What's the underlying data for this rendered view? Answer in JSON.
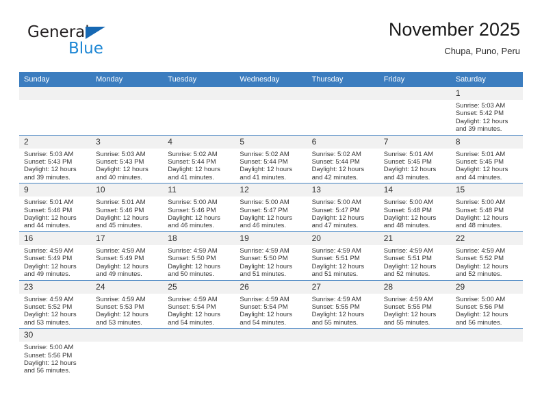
{
  "brand": {
    "name_part1": "General",
    "name_part2": "Blue",
    "accent_color": "#1c86d4",
    "logo_triangle_color": "#1668b3"
  },
  "header": {
    "month_title": "November 2025",
    "location": "Chupa, Puno, Peru"
  },
  "theme": {
    "header_row_color": "#3C7DBF",
    "daynum_band_color": "#F1F1F1",
    "text_color": "#333333"
  },
  "weekday_headers": [
    "Sunday",
    "Monday",
    "Tuesday",
    "Wednesday",
    "Thursday",
    "Friday",
    "Saturday"
  ],
  "labels": {
    "sunrise_prefix": "Sunrise:",
    "sunset_prefix": "Sunset:",
    "daylight_prefix": "Daylight:"
  },
  "weeks": [
    [
      {
        "day": "",
        "empty": true
      },
      {
        "day": "",
        "empty": true
      },
      {
        "day": "",
        "empty": true
      },
      {
        "day": "",
        "empty": true
      },
      {
        "day": "",
        "empty": true
      },
      {
        "day": "",
        "empty": true
      },
      {
        "day": "1",
        "sunrise": "Sunrise: 5:03 AM",
        "sunset": "Sunset: 5:42 PM",
        "daylight": "Daylight: 12 hours and 39 minutes."
      }
    ],
    [
      {
        "day": "2",
        "sunrise": "Sunrise: 5:03 AM",
        "sunset": "Sunset: 5:43 PM",
        "daylight": "Daylight: 12 hours and 39 minutes."
      },
      {
        "day": "3",
        "sunrise": "Sunrise: 5:03 AM",
        "sunset": "Sunset: 5:43 PM",
        "daylight": "Daylight: 12 hours and 40 minutes."
      },
      {
        "day": "4",
        "sunrise": "Sunrise: 5:02 AM",
        "sunset": "Sunset: 5:44 PM",
        "daylight": "Daylight: 12 hours and 41 minutes."
      },
      {
        "day": "5",
        "sunrise": "Sunrise: 5:02 AM",
        "sunset": "Sunset: 5:44 PM",
        "daylight": "Daylight: 12 hours and 41 minutes."
      },
      {
        "day": "6",
        "sunrise": "Sunrise: 5:02 AM",
        "sunset": "Sunset: 5:44 PM",
        "daylight": "Daylight: 12 hours and 42 minutes."
      },
      {
        "day": "7",
        "sunrise": "Sunrise: 5:01 AM",
        "sunset": "Sunset: 5:45 PM",
        "daylight": "Daylight: 12 hours and 43 minutes."
      },
      {
        "day": "8",
        "sunrise": "Sunrise: 5:01 AM",
        "sunset": "Sunset: 5:45 PM",
        "daylight": "Daylight: 12 hours and 44 minutes."
      }
    ],
    [
      {
        "day": "9",
        "sunrise": "Sunrise: 5:01 AM",
        "sunset": "Sunset: 5:46 PM",
        "daylight": "Daylight: 12 hours and 44 minutes."
      },
      {
        "day": "10",
        "sunrise": "Sunrise: 5:01 AM",
        "sunset": "Sunset: 5:46 PM",
        "daylight": "Daylight: 12 hours and 45 minutes."
      },
      {
        "day": "11",
        "sunrise": "Sunrise: 5:00 AM",
        "sunset": "Sunset: 5:46 PM",
        "daylight": "Daylight: 12 hours and 46 minutes."
      },
      {
        "day": "12",
        "sunrise": "Sunrise: 5:00 AM",
        "sunset": "Sunset: 5:47 PM",
        "daylight": "Daylight: 12 hours and 46 minutes."
      },
      {
        "day": "13",
        "sunrise": "Sunrise: 5:00 AM",
        "sunset": "Sunset: 5:47 PM",
        "daylight": "Daylight: 12 hours and 47 minutes."
      },
      {
        "day": "14",
        "sunrise": "Sunrise: 5:00 AM",
        "sunset": "Sunset: 5:48 PM",
        "daylight": "Daylight: 12 hours and 48 minutes."
      },
      {
        "day": "15",
        "sunrise": "Sunrise: 5:00 AM",
        "sunset": "Sunset: 5:48 PM",
        "daylight": "Daylight: 12 hours and 48 minutes."
      }
    ],
    [
      {
        "day": "16",
        "sunrise": "Sunrise: 4:59 AM",
        "sunset": "Sunset: 5:49 PM",
        "daylight": "Daylight: 12 hours and 49 minutes."
      },
      {
        "day": "17",
        "sunrise": "Sunrise: 4:59 AM",
        "sunset": "Sunset: 5:49 PM",
        "daylight": "Daylight: 12 hours and 49 minutes."
      },
      {
        "day": "18",
        "sunrise": "Sunrise: 4:59 AM",
        "sunset": "Sunset: 5:50 PM",
        "daylight": "Daylight: 12 hours and 50 minutes."
      },
      {
        "day": "19",
        "sunrise": "Sunrise: 4:59 AM",
        "sunset": "Sunset: 5:50 PM",
        "daylight": "Daylight: 12 hours and 51 minutes."
      },
      {
        "day": "20",
        "sunrise": "Sunrise: 4:59 AM",
        "sunset": "Sunset: 5:51 PM",
        "daylight": "Daylight: 12 hours and 51 minutes."
      },
      {
        "day": "21",
        "sunrise": "Sunrise: 4:59 AM",
        "sunset": "Sunset: 5:51 PM",
        "daylight": "Daylight: 12 hours and 52 minutes."
      },
      {
        "day": "22",
        "sunrise": "Sunrise: 4:59 AM",
        "sunset": "Sunset: 5:52 PM",
        "daylight": "Daylight: 12 hours and 52 minutes."
      }
    ],
    [
      {
        "day": "23",
        "sunrise": "Sunrise: 4:59 AM",
        "sunset": "Sunset: 5:52 PM",
        "daylight": "Daylight: 12 hours and 53 minutes."
      },
      {
        "day": "24",
        "sunrise": "Sunrise: 4:59 AM",
        "sunset": "Sunset: 5:53 PM",
        "daylight": "Daylight: 12 hours and 53 minutes."
      },
      {
        "day": "25",
        "sunrise": "Sunrise: 4:59 AM",
        "sunset": "Sunset: 5:54 PM",
        "daylight": "Daylight: 12 hours and 54 minutes."
      },
      {
        "day": "26",
        "sunrise": "Sunrise: 4:59 AM",
        "sunset": "Sunset: 5:54 PM",
        "daylight": "Daylight: 12 hours and 54 minutes."
      },
      {
        "day": "27",
        "sunrise": "Sunrise: 4:59 AM",
        "sunset": "Sunset: 5:55 PM",
        "daylight": "Daylight: 12 hours and 55 minutes."
      },
      {
        "day": "28",
        "sunrise": "Sunrise: 4:59 AM",
        "sunset": "Sunset: 5:55 PM",
        "daylight": "Daylight: 12 hours and 55 minutes."
      },
      {
        "day": "29",
        "sunrise": "Sunrise: 5:00 AM",
        "sunset": "Sunset: 5:56 PM",
        "daylight": "Daylight: 12 hours and 56 minutes."
      }
    ],
    [
      {
        "day": "30",
        "sunrise": "Sunrise: 5:00 AM",
        "sunset": "Sunset: 5:56 PM",
        "daylight": "Daylight: 12 hours and 56 minutes."
      },
      {
        "day": "",
        "empty": true
      },
      {
        "day": "",
        "empty": true
      },
      {
        "day": "",
        "empty": true
      },
      {
        "day": "",
        "empty": true
      },
      {
        "day": "",
        "empty": true
      },
      {
        "day": "",
        "empty": true
      }
    ]
  ]
}
